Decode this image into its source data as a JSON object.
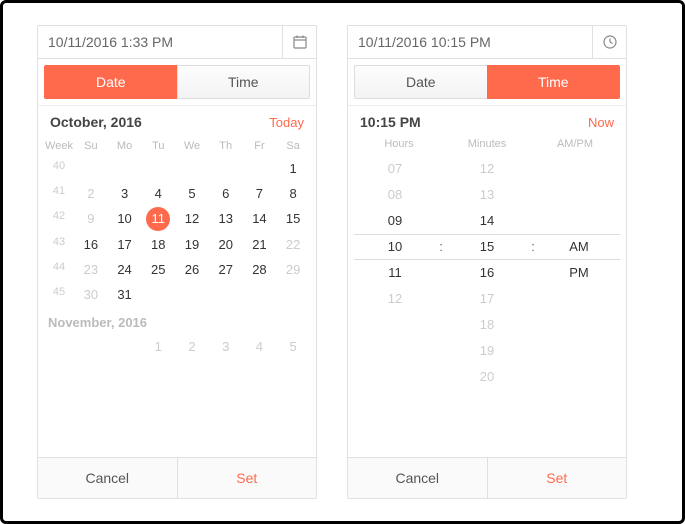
{
  "left": {
    "input_value": "10/11/2016 1:33 PM",
    "tabs": {
      "date": "Date",
      "time": "Time",
      "active": "date"
    },
    "header": {
      "title": "October, 2016",
      "link": "Today"
    },
    "dow_label": "Week",
    "dow": [
      "Su",
      "Mo",
      "Tu",
      "We",
      "Th",
      "Fr",
      "Sa"
    ],
    "weeks": [
      {
        "wk": "40",
        "days": [
          {
            "n": "",
            "out": true
          },
          {
            "n": "",
            "out": true
          },
          {
            "n": "",
            "out": true
          },
          {
            "n": "",
            "out": true
          },
          {
            "n": "",
            "out": true
          },
          {
            "n": "",
            "out": true
          },
          {
            "n": "1"
          }
        ]
      },
      {
        "wk": "41",
        "days": [
          {
            "n": "2",
            "out": true
          },
          {
            "n": "3"
          },
          {
            "n": "4"
          },
          {
            "n": "5"
          },
          {
            "n": "6"
          },
          {
            "n": "7"
          },
          {
            "n": "8"
          }
        ]
      },
      {
        "wk": "42",
        "days": [
          {
            "n": "9",
            "out": true
          },
          {
            "n": "10"
          },
          {
            "n": "11",
            "sel": true
          },
          {
            "n": "12"
          },
          {
            "n": "13"
          },
          {
            "n": "14"
          },
          {
            "n": "15"
          }
        ]
      },
      {
        "wk": "43",
        "days": [
          {
            "n": "16"
          },
          {
            "n": "17"
          },
          {
            "n": "18"
          },
          {
            "n": "19"
          },
          {
            "n": "20"
          },
          {
            "n": "21"
          },
          {
            "n": "22",
            "out": true
          }
        ]
      },
      {
        "wk": "44",
        "days": [
          {
            "n": "23",
            "out": true
          },
          {
            "n": "24"
          },
          {
            "n": "25"
          },
          {
            "n": "26"
          },
          {
            "n": "27"
          },
          {
            "n": "28"
          },
          {
            "n": "29",
            "out": true
          }
        ]
      },
      {
        "wk": "45",
        "days": [
          {
            "n": "30",
            "out": true
          },
          {
            "n": "31"
          },
          {
            "n": "",
            "out": true
          },
          {
            "n": "",
            "out": true
          },
          {
            "n": "",
            "out": true
          },
          {
            "n": "",
            "out": true
          },
          {
            "n": "",
            "out": true
          }
        ]
      }
    ],
    "next_month": {
      "title": "November, 2016",
      "wk": "",
      "days": [
        {
          "n": "",
          "out": true
        },
        {
          "n": "",
          "out": true
        },
        {
          "n": "1",
          "out": true
        },
        {
          "n": "2",
          "out": true
        },
        {
          "n": "3",
          "out": true
        },
        {
          "n": "4",
          "out": true
        },
        {
          "n": "5",
          "out": true
        }
      ]
    },
    "footer": {
      "cancel": "Cancel",
      "set": "Set"
    }
  },
  "right": {
    "input_value": "10/11/2016 10:15 PM",
    "tabs": {
      "date": "Date",
      "time": "Time",
      "active": "time"
    },
    "header": {
      "title": "10:15 PM",
      "link": "Now"
    },
    "cols": {
      "hours": "Hours",
      "minutes": "Minutes",
      "ampm": "AM/PM"
    },
    "hours": [
      "07",
      "08",
      "09",
      "10",
      "11",
      "12",
      "",
      ""
    ],
    "minutes": [
      "12",
      "13",
      "14",
      "15",
      "16",
      "17",
      "18",
      "19",
      "20"
    ],
    "ampm": [
      "",
      "",
      "",
      "AM",
      "PM",
      "",
      "",
      ""
    ],
    "selected_index": 3,
    "footer": {
      "cancel": "Cancel",
      "set": "Set"
    }
  }
}
